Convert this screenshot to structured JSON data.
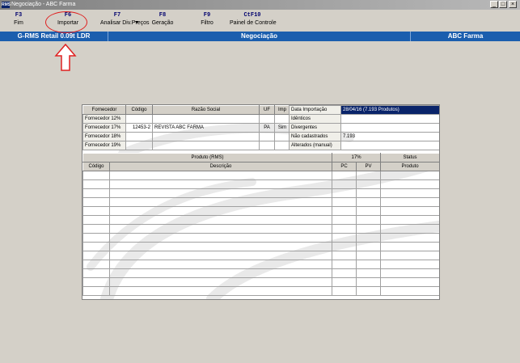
{
  "window": {
    "title": "Negociação - ABC Farma",
    "icon": "app-icon",
    "icon_text": "RMS"
  },
  "window_controls": {
    "minimize": "_",
    "maximize": "□",
    "close": "×"
  },
  "toolbar": [
    {
      "key": "F3",
      "label": "Fim"
    },
    {
      "key": "F6",
      "label": "Importar"
    },
    {
      "key": "F7",
      "label": "Analisar Div.Preços"
    },
    {
      "key": "F8",
      "label": "Geração"
    },
    {
      "key": "F9",
      "label": "Filtro"
    },
    {
      "key": "CtF10",
      "label": "Painel de Controle"
    }
  ],
  "header_bar": {
    "left": "G-RMS Retail 0.09t LDR",
    "center": "Negociação",
    "right": "ABC Farma"
  },
  "fornecedor_table": {
    "headers": [
      "Fornecedor",
      "Código",
      "Razão Social",
      "UF",
      "Imp"
    ],
    "rows": [
      [
        "Fornecedor 12%",
        "",
        "",
        "",
        ""
      ],
      [
        "Fornecedor 17%",
        "12453-2",
        "REVISTA ABC FARMA",
        "PA",
        "Sim"
      ],
      [
        "Fornecedor 18%",
        "",
        "",
        "",
        ""
      ],
      [
        "Fornecedor 19%",
        "",
        "",
        "",
        ""
      ]
    ]
  },
  "import_info": {
    "rows": [
      {
        "label": "Data Importação",
        "value": "28/04/16   (7.193 Produtos)"
      },
      {
        "label": "Idênticos",
        "value": ""
      },
      {
        "label": "Divergentes",
        "value": ""
      },
      {
        "label": "Não cadastrados",
        "value": "7.193"
      },
      {
        "label": "Alterados (manual)",
        "value": ""
      }
    ]
  },
  "produto_table": {
    "group_headers": {
      "produto": "Produto (RMS)",
      "pct": "17%",
      "status": "Status"
    },
    "headers": [
      "Código",
      "Descrição",
      "PC",
      "PV",
      "Produto"
    ],
    "row_count": 14
  },
  "colors": {
    "header_blue": "#1b5eae",
    "selection": "#0a246a",
    "annotation": "#e02020"
  }
}
